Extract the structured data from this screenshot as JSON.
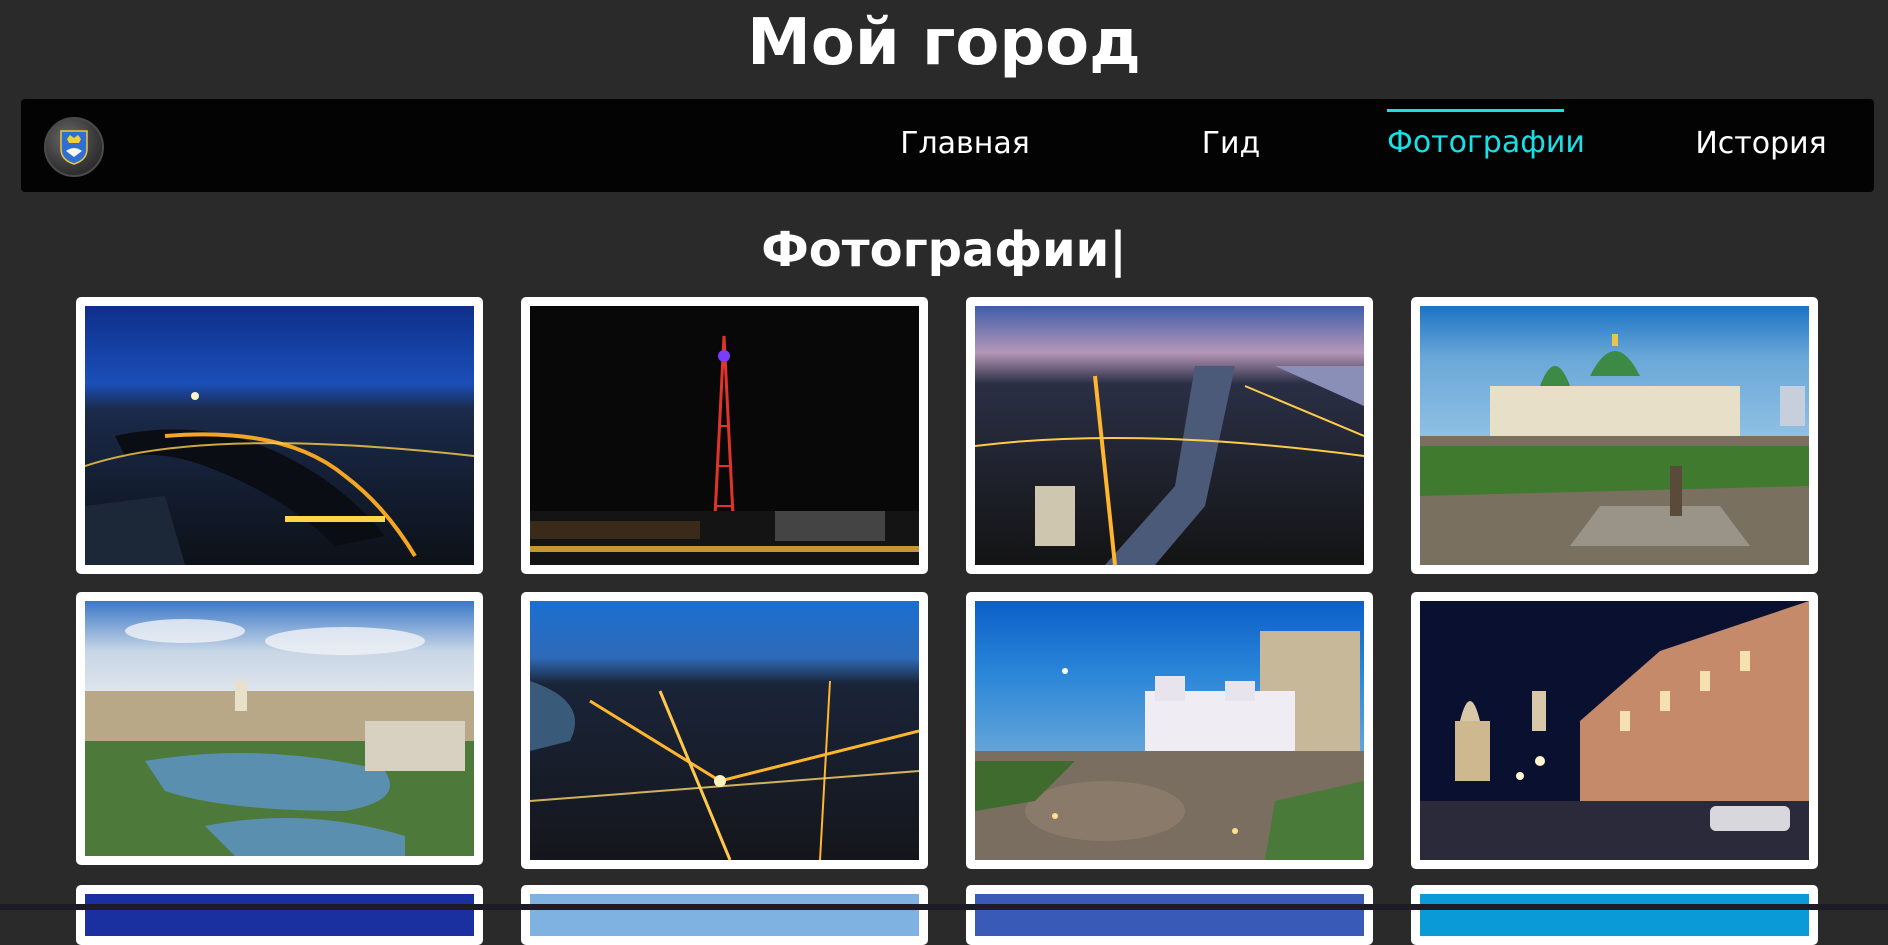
{
  "header": {
    "title": "Мой город"
  },
  "nav": {
    "logo_icon": "city-coat-of-arms-icon",
    "items": [
      {
        "label": "Главная",
        "active": false
      },
      {
        "label": "Гид",
        "active": false
      },
      {
        "label": "Фотографии",
        "active": true
      },
      {
        "label": "История",
        "active": false
      }
    ],
    "active_color": "#19e0e6"
  },
  "main": {
    "heading": "Фотографии|",
    "photos": [
      {
        "subject": "night-city-panorama"
      },
      {
        "subject": "illuminated-tv-tower"
      },
      {
        "subject": "aerial-night-river-city"
      },
      {
        "subject": "cathedral-square"
      },
      {
        "subject": "city-lake-daytime"
      },
      {
        "subject": "aerial-night-city"
      },
      {
        "subject": "theatre-evening"
      },
      {
        "subject": "night-street-buildings"
      },
      {
        "subject": "partial-photo"
      },
      {
        "subject": "partial-photo"
      },
      {
        "subject": "partial-photo"
      },
      {
        "subject": "partial-photo"
      }
    ]
  },
  "colors": {
    "background": "#2b2a2b",
    "navbar": "#030303",
    "card": "#ffffff"
  }
}
